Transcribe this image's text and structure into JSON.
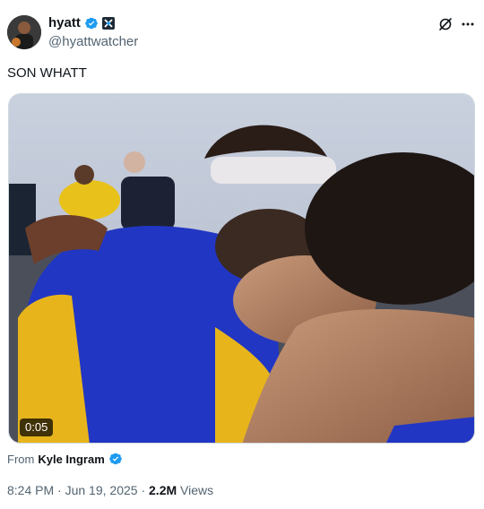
{
  "author": {
    "display_name": "hyatt",
    "handle": "@hyattwatcher",
    "avatar_icon": "profile-avatar",
    "verified_icon": "verified-badge-icon",
    "affiliate_icon": "x-affiliate-icon"
  },
  "tweet": {
    "text": "SON WHATT",
    "video_duration": "0:05"
  },
  "source": {
    "prefix": "From",
    "name": "Kyle Ingram"
  },
  "meta": {
    "time": "8:24 PM",
    "sep1": "·",
    "date": "Jun 19, 2025",
    "sep2": "·",
    "views_count": "2.2M",
    "views_label": "Views"
  },
  "colors": {
    "verified_blue": "#1d9bf0",
    "secondary_text": "#536471",
    "primary_text": "#0f1419"
  }
}
